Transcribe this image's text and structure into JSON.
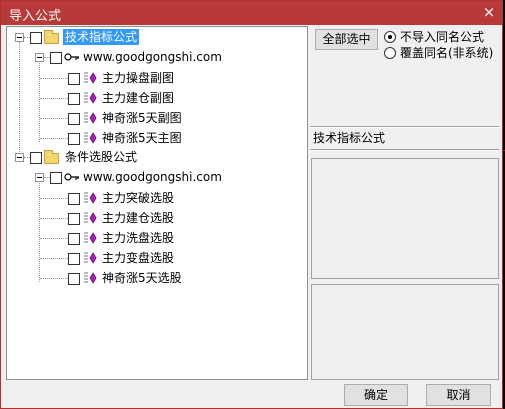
{
  "window": {
    "title": "导入公式",
    "close_glyph": "×"
  },
  "tree": {
    "groups": [
      {
        "label": "技术指标公式",
        "site": "www.goodgongshi.com",
        "items": [
          "主力操盘副图",
          "主力建仓副图",
          "神奇涨5天副图",
          "神奇涨5天主图"
        ]
      },
      {
        "label": "条件选股公式",
        "site": "www.goodgongshi.com",
        "items": [
          "主力突破选股",
          "主力建仓选股",
          "主力洗盘选股",
          "主力变盘选股",
          "神奇涨5天选股"
        ]
      }
    ]
  },
  "side": {
    "select_all": "全部选中",
    "options": [
      {
        "label": "不导入同名公式",
        "checked": true
      },
      {
        "label": "覆盖同名(非系统)",
        "checked": false
      }
    ],
    "desc_title": "技术指标公式"
  },
  "footer": {
    "ok": "确定",
    "cancel": "取消"
  }
}
